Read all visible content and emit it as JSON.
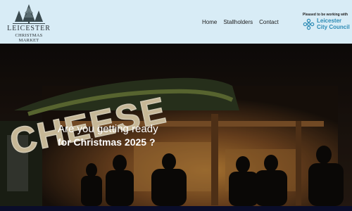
{
  "logo": {
    "name_line1": "LEICESTER",
    "name_line2": "CHRISTMAS MARKET",
    "icon": "christmas-trees-icon"
  },
  "nav": {
    "items": [
      {
        "label": "Home"
      },
      {
        "label": "Stallholders"
      },
      {
        "label": "Contact"
      }
    ]
  },
  "partner": {
    "caption": "Pleased to be working with",
    "name_line1": "Leicester",
    "name_line2": "City Council",
    "icon": "city-council-icon"
  },
  "hero": {
    "sign_text": "CHEESE",
    "title_line1": "Are you getting ready",
    "title_line2": "for Christmas 2025 ?"
  },
  "colors": {
    "header_bg": "#d8ecf6",
    "council_blue": "#2c8bb5",
    "footer_bar": "#0a0d2a"
  }
}
